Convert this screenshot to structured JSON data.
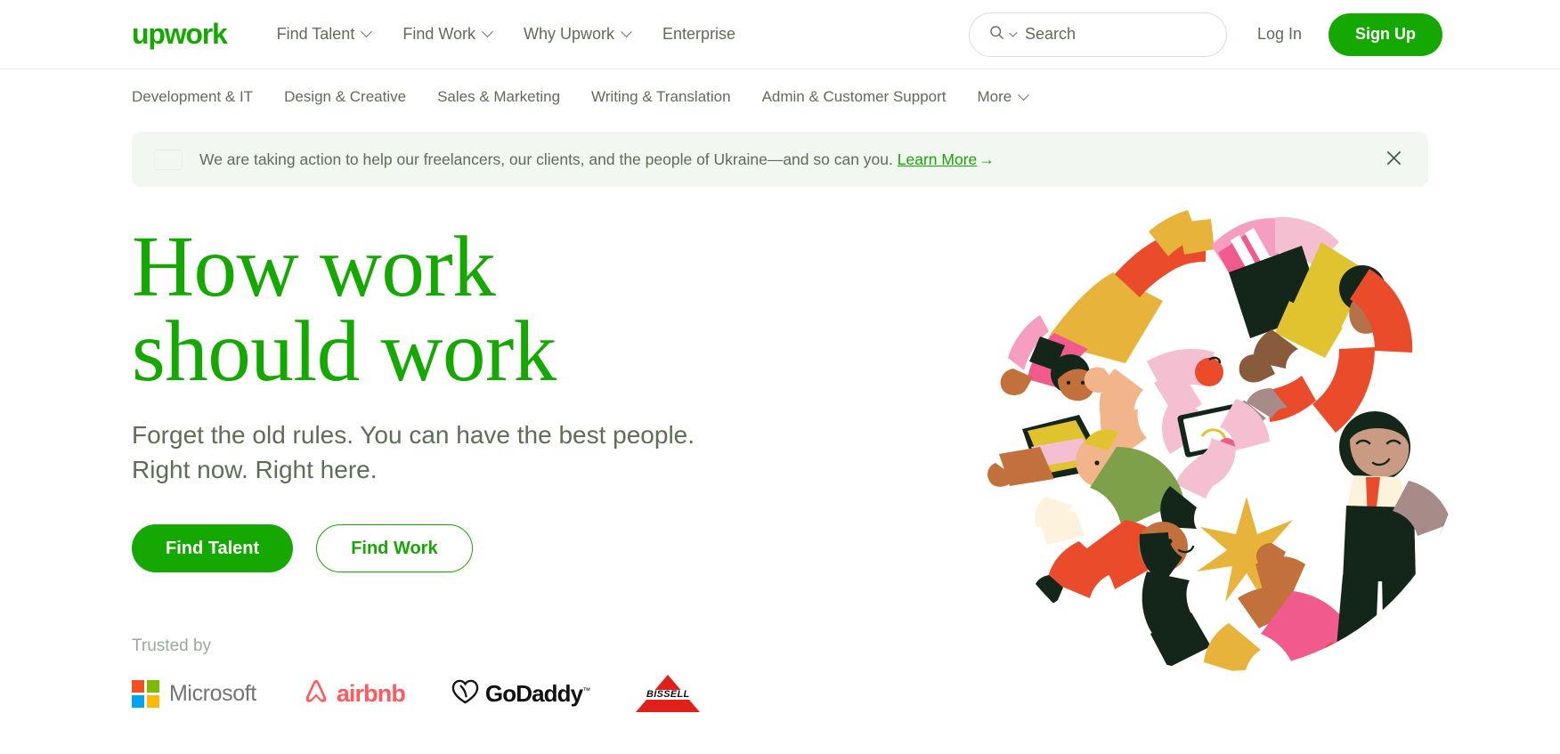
{
  "brand": {
    "logo_text": "upwork",
    "accent_color": "#14a800"
  },
  "header": {
    "nav": [
      {
        "label": "Find Talent",
        "has_caret": true,
        "icon": "chevron-down-icon"
      },
      {
        "label": "Find Work",
        "has_caret": true,
        "icon": "chevron-down-icon"
      },
      {
        "label": "Why Upwork",
        "has_caret": true,
        "icon": "chevron-down-icon"
      },
      {
        "label": "Enterprise",
        "has_caret": false,
        "icon": ""
      }
    ],
    "search": {
      "placeholder": "Search",
      "value": "",
      "icon": "search-icon",
      "dropdown_icon": "chevron-down-icon"
    },
    "login_label": "Log In",
    "signup_label": "Sign Up"
  },
  "categories": [
    {
      "label": "Development & IT",
      "has_caret": false
    },
    {
      "label": "Design & Creative",
      "has_caret": false
    },
    {
      "label": "Sales & Marketing",
      "has_caret": false
    },
    {
      "label": "Writing & Translation",
      "has_caret": false
    },
    {
      "label": "Admin & Customer Support",
      "has_caret": false
    },
    {
      "label": "More",
      "has_caret": true
    }
  ],
  "banner": {
    "flag_icon": "ukraine-flag-icon",
    "text": "We are taking action to help our freelancers, our clients, and the people of Ukraine—and so can you.",
    "link_label": "Learn More",
    "link_arrow": "→",
    "close_icon": "close-icon",
    "background_color": "#f2f7f2"
  },
  "hero": {
    "title_line1": "How work",
    "title_line2": "should work",
    "subtitle_line1": "Forget the old rules. You can have the best people.",
    "subtitle_line2": "Right now. Right here.",
    "cta_primary": "Find Talent",
    "cta_secondary": "Find Work",
    "illustration_name": "people-collage-circle-illustration"
  },
  "trusted": {
    "label": "Trusted by",
    "logos": [
      {
        "name": "microsoft-logo",
        "text": "Microsoft"
      },
      {
        "name": "airbnb-logo",
        "text": "airbnb"
      },
      {
        "name": "godaddy-logo",
        "text": "GoDaddy"
      },
      {
        "name": "bissell-logo",
        "text": "BISSELL"
      }
    ]
  }
}
